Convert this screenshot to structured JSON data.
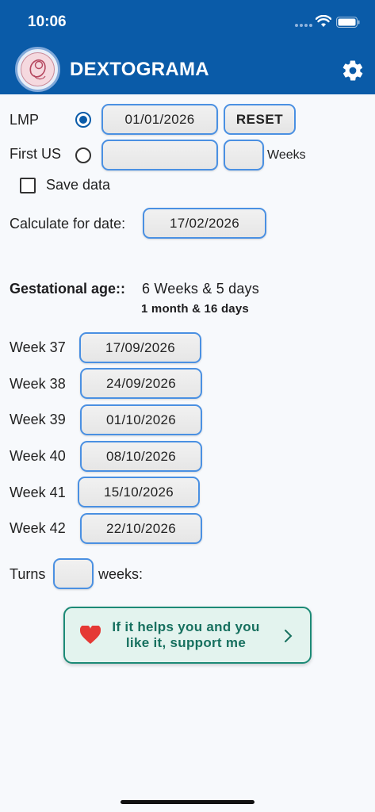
{
  "status_bar": {
    "time": "10:06",
    "icons": [
      "signal-dots-icon",
      "wifi-icon",
      "battery-icon"
    ]
  },
  "app_bar": {
    "title": "DEXTOGRAMA",
    "logo": "fetus-logo",
    "settings_icon": "gear-icon"
  },
  "colors": {
    "primary": "#0a5ba8",
    "field_border": "#4a90e2",
    "support_green": "#1c8a76",
    "heart_red": "#e53935"
  },
  "form": {
    "lmp_label": "LMP",
    "lmp_selected": true,
    "lmp_date": "01/01/2026",
    "reset_label": "RESET",
    "first_us_label": "First US",
    "first_us_selected": false,
    "first_us_date": "",
    "first_us_weeks": "",
    "weeks_label": "Weeks",
    "save_data_label": "Save data",
    "save_data_checked": false,
    "calc_label": "Calculate for date:",
    "calc_date": "17/02/2026"
  },
  "gestational_age": {
    "label": "Gestational age::",
    "value": "6 Weeks & 5 days",
    "months": "1 month & 16 days"
  },
  "weeks": [
    {
      "label": "Week 37",
      "date": "17/09/2026"
    },
    {
      "label": "Week 38",
      "date": "24/09/2026"
    },
    {
      "label": "Week 39",
      "date": "01/10/2026"
    },
    {
      "label": "Week 40",
      "date": "08/10/2026"
    },
    {
      "label": "Week 41",
      "date": "15/10/2026"
    },
    {
      "label": "Week 42",
      "date": "22/10/2026"
    }
  ],
  "turns": {
    "label": "Turns",
    "value": "",
    "suffix": "weeks:"
  },
  "support": {
    "text": "If it helps you and you like it, support me"
  }
}
